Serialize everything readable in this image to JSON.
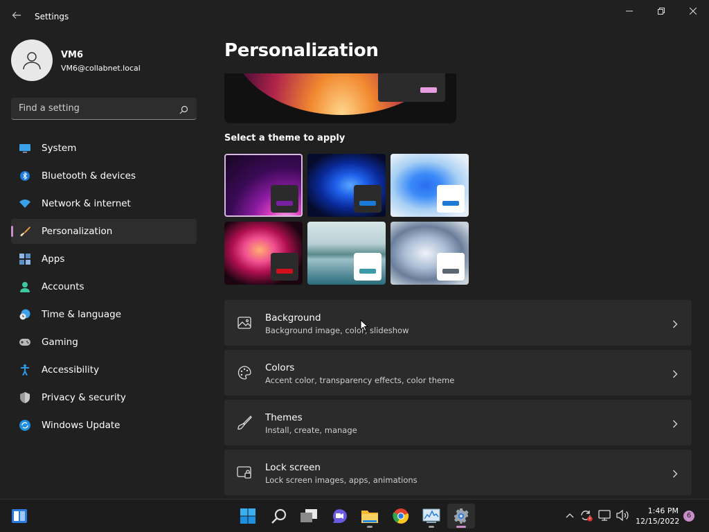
{
  "window": {
    "title": "Settings"
  },
  "profile": {
    "name": "VM6",
    "email": "VM6@collabnet.local"
  },
  "search": {
    "placeholder": "Find a setting"
  },
  "nav": {
    "items": [
      {
        "label": "System",
        "icon": "system-icon"
      },
      {
        "label": "Bluetooth & devices",
        "icon": "bluetooth-icon"
      },
      {
        "label": "Network & internet",
        "icon": "wifi-icon"
      },
      {
        "label": "Personalization",
        "icon": "brush-icon",
        "active": true
      },
      {
        "label": "Apps",
        "icon": "apps-icon"
      },
      {
        "label": "Accounts",
        "icon": "accounts-icon"
      },
      {
        "label": "Time & language",
        "icon": "clock-globe-icon"
      },
      {
        "label": "Gaming",
        "icon": "gamepad-icon"
      },
      {
        "label": "Accessibility",
        "icon": "accessibility-icon"
      },
      {
        "label": "Privacy & security",
        "icon": "shield-icon"
      },
      {
        "label": "Windows Update",
        "icon": "update-icon"
      }
    ]
  },
  "page": {
    "title": "Personalization",
    "theme_section_label": "Select a theme to apply",
    "themes": [
      {
        "name": "theme-glow-dark",
        "accent": "#7a1fa0",
        "mini_bg": "#2b2b2b"
      },
      {
        "name": "theme-bloom-dark",
        "accent": "#1a7ad6",
        "mini_bg": "#2b2b2b"
      },
      {
        "name": "theme-bloom-light",
        "accent": "#1a7ad6",
        "mini_bg": "#ffffff"
      },
      {
        "name": "theme-flower-dark",
        "accent": "#d0101a",
        "mini_bg": "#2b2b2b"
      },
      {
        "name": "theme-lake-light",
        "accent": "#3b9aa8",
        "mini_bg": "#ffffff"
      },
      {
        "name": "theme-sculpture-light",
        "accent": "#5c6670",
        "mini_bg": "#ffffff"
      }
    ],
    "cards": [
      {
        "title": "Background",
        "subtitle": "Background image, color, slideshow",
        "icon": "image-icon"
      },
      {
        "title": "Colors",
        "subtitle": "Accent color, transparency effects, color theme",
        "icon": "palette-icon"
      },
      {
        "title": "Themes",
        "subtitle": "Install, create, manage",
        "icon": "brush-icon"
      },
      {
        "title": "Lock screen",
        "subtitle": "Lock screen images, apps, animations",
        "icon": "lock-screen-icon"
      }
    ]
  },
  "taskbar": {
    "apps": [
      "start-icon",
      "search-icon",
      "task-view-icon",
      "teams-chat-icon",
      "file-explorer-icon",
      "chrome-icon",
      "resource-monitor-icon",
      "settings-icon"
    ],
    "time": "1:46 PM",
    "date": "12/15/2022",
    "notification_count": "6"
  },
  "colors": {
    "accent": "#c78ec9",
    "background": "#202020",
    "card": "#2b2b2b"
  }
}
